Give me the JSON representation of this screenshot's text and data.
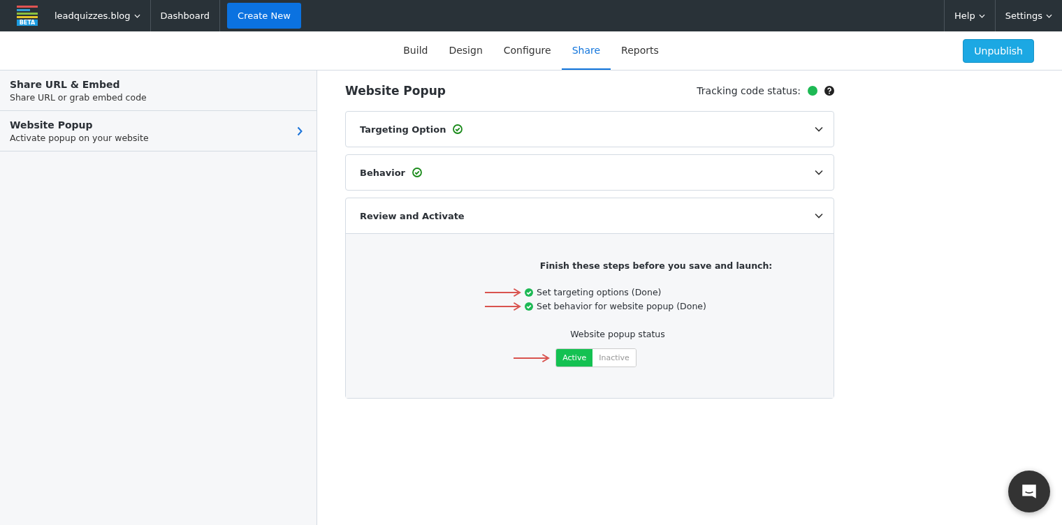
{
  "topbar": {
    "logo_badge": "BETA",
    "workspace": "leadquizzes.blog",
    "links": [
      "Dashboard"
    ],
    "create_button": "Create New",
    "right_menus": [
      "Help",
      "Settings"
    ]
  },
  "tabs": [
    {
      "label": "Build",
      "selected": false
    },
    {
      "label": "Design",
      "selected": false
    },
    {
      "label": "Configure",
      "selected": false
    },
    {
      "label": "Share",
      "selected": true
    },
    {
      "label": "Reports",
      "selected": false
    }
  ],
  "unpublish_button": "Unpublish",
  "sidebar": {
    "items": [
      {
        "title": "Share URL & Embed",
        "subtitle": "Share URL or grab embed code",
        "selected": false
      },
      {
        "title": "Website Popup",
        "subtitle": "Activate popup on your website",
        "selected": true
      }
    ]
  },
  "main": {
    "title": "Website Popup",
    "tracking_label": "Tracking code status:",
    "tracking_ok": true,
    "sections": [
      {
        "title": "Targeting Option",
        "completed": true,
        "expanded": false
      },
      {
        "title": "Behavior",
        "completed": true,
        "expanded": false
      },
      {
        "title": "Review and Activate",
        "completed": false,
        "expanded": true
      }
    ],
    "review": {
      "heading": "Finish these steps before you save and launch:",
      "steps": [
        {
          "text": "Set targeting options (Done)",
          "done": true,
          "arrow": true
        },
        {
          "text": "Set behavior for website popup (Done)",
          "done": true,
          "arrow": true
        }
      ],
      "status_label": "Website popup status",
      "status_arrow": true,
      "status_options": [
        {
          "label": "Active",
          "selected": true
        },
        {
          "label": "Inactive",
          "selected": false
        }
      ]
    }
  }
}
